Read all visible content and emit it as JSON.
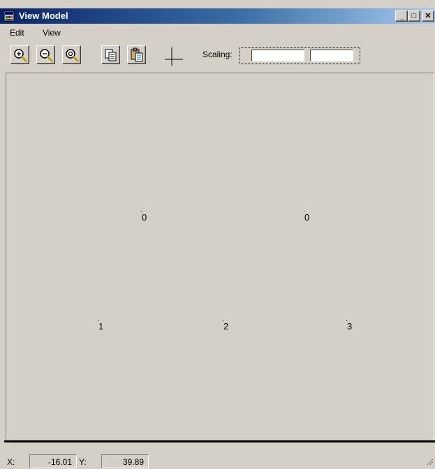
{
  "window": {
    "title": "View Model",
    "minimize_label": "_",
    "maximize_label": "□",
    "close_label": "✕"
  },
  "menu": {
    "items": [
      "Edit",
      "View"
    ]
  },
  "toolbar": {
    "buttons": [
      "zoom-in-icon",
      "zoom-out-icon",
      "zoom-reset-icon",
      "copy-icon",
      "paste-icon",
      "crosshair-icon"
    ],
    "scaling_label": "Scaling:",
    "scale_x_value": "",
    "scale_y_value": ""
  },
  "canvas": {
    "nodes": [
      {
        "label": "0"
      },
      {
        "label": "0"
      },
      {
        "label": "1"
      },
      {
        "label": "2"
      },
      {
        "label": "3"
      }
    ]
  },
  "status": {
    "x_label": "X:",
    "x_value": "-16.01",
    "y_label": "Y:",
    "y_value": "39.89"
  }
}
